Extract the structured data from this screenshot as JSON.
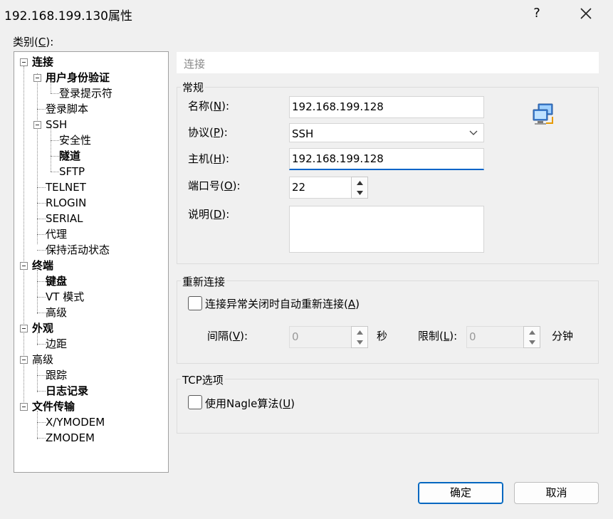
{
  "window": {
    "title": "192.168.199.130属性",
    "help": "?"
  },
  "category": {
    "label_pre": "类别(",
    "label_key": "C",
    "label_post": "):"
  },
  "tree": [
    {
      "label": "连接",
      "bold": true
    },
    {
      "label": "用户身份验证",
      "bold": true
    },
    {
      "label": "登录提示符",
      "bold": false
    },
    {
      "label": "登录脚本",
      "bold": false
    },
    {
      "label": "SSH",
      "bold": false
    },
    {
      "label": "安全性",
      "bold": false
    },
    {
      "label": "隧道",
      "bold": true
    },
    {
      "label": "SFTP",
      "bold": false
    },
    {
      "label": "TELNET",
      "bold": false
    },
    {
      "label": "RLOGIN",
      "bold": false
    },
    {
      "label": "SERIAL",
      "bold": false
    },
    {
      "label": "代理",
      "bold": false
    },
    {
      "label": "保持活动状态",
      "bold": false
    },
    {
      "label": "终端",
      "bold": true
    },
    {
      "label": "键盘",
      "bold": true
    },
    {
      "label": "VT 模式",
      "bold": false
    },
    {
      "label": "高级",
      "bold": false
    },
    {
      "label": "外观",
      "bold": true
    },
    {
      "label": "边距",
      "bold": false
    },
    {
      "label": "高级",
      "bold": false
    },
    {
      "label": "跟踪",
      "bold": false
    },
    {
      "label": "日志记录",
      "bold": true
    },
    {
      "label": "文件传输",
      "bold": true
    },
    {
      "label": "X/YMODEM",
      "bold": false
    },
    {
      "label": "ZMODEM",
      "bold": false
    }
  ],
  "section": {
    "title": "连接"
  },
  "general": {
    "title": "常规",
    "name": {
      "pre": "名称(",
      "key": "N",
      "post": "):",
      "value": "192.168.199.128"
    },
    "protocol": {
      "pre": "协议(",
      "key": "P",
      "post": "):",
      "value": "SSH"
    },
    "host": {
      "pre": "主机(",
      "key": "H",
      "post": "):",
      "value": "192.168.199.128"
    },
    "port": {
      "pre": "端口号(",
      "key": "O",
      "post": "):",
      "value": "22"
    },
    "desc": {
      "pre": "说明(",
      "key": "D",
      "post": "):",
      "value": ""
    }
  },
  "reconnect": {
    "title": "重新连接",
    "auto": {
      "pre": "连接异常关闭时自动重新连接(",
      "key": "A",
      "post": ")"
    },
    "interval": {
      "pre": "间隔(",
      "key": "V",
      "post": "):",
      "value": "0",
      "unit": "秒"
    },
    "limit": {
      "pre": "限制(",
      "key": "L",
      "post": "):",
      "value": "0",
      "unit": "分钟"
    }
  },
  "tcp": {
    "title": "TCP选项",
    "nagle": {
      "pre": "使用Nagle算法(",
      "key": "U",
      "post": ")"
    }
  },
  "buttons": {
    "ok": "确定",
    "cancel": "取消"
  },
  "colors": {
    "accent": "#0067c0",
    "focus_underline": "#0064c8"
  }
}
